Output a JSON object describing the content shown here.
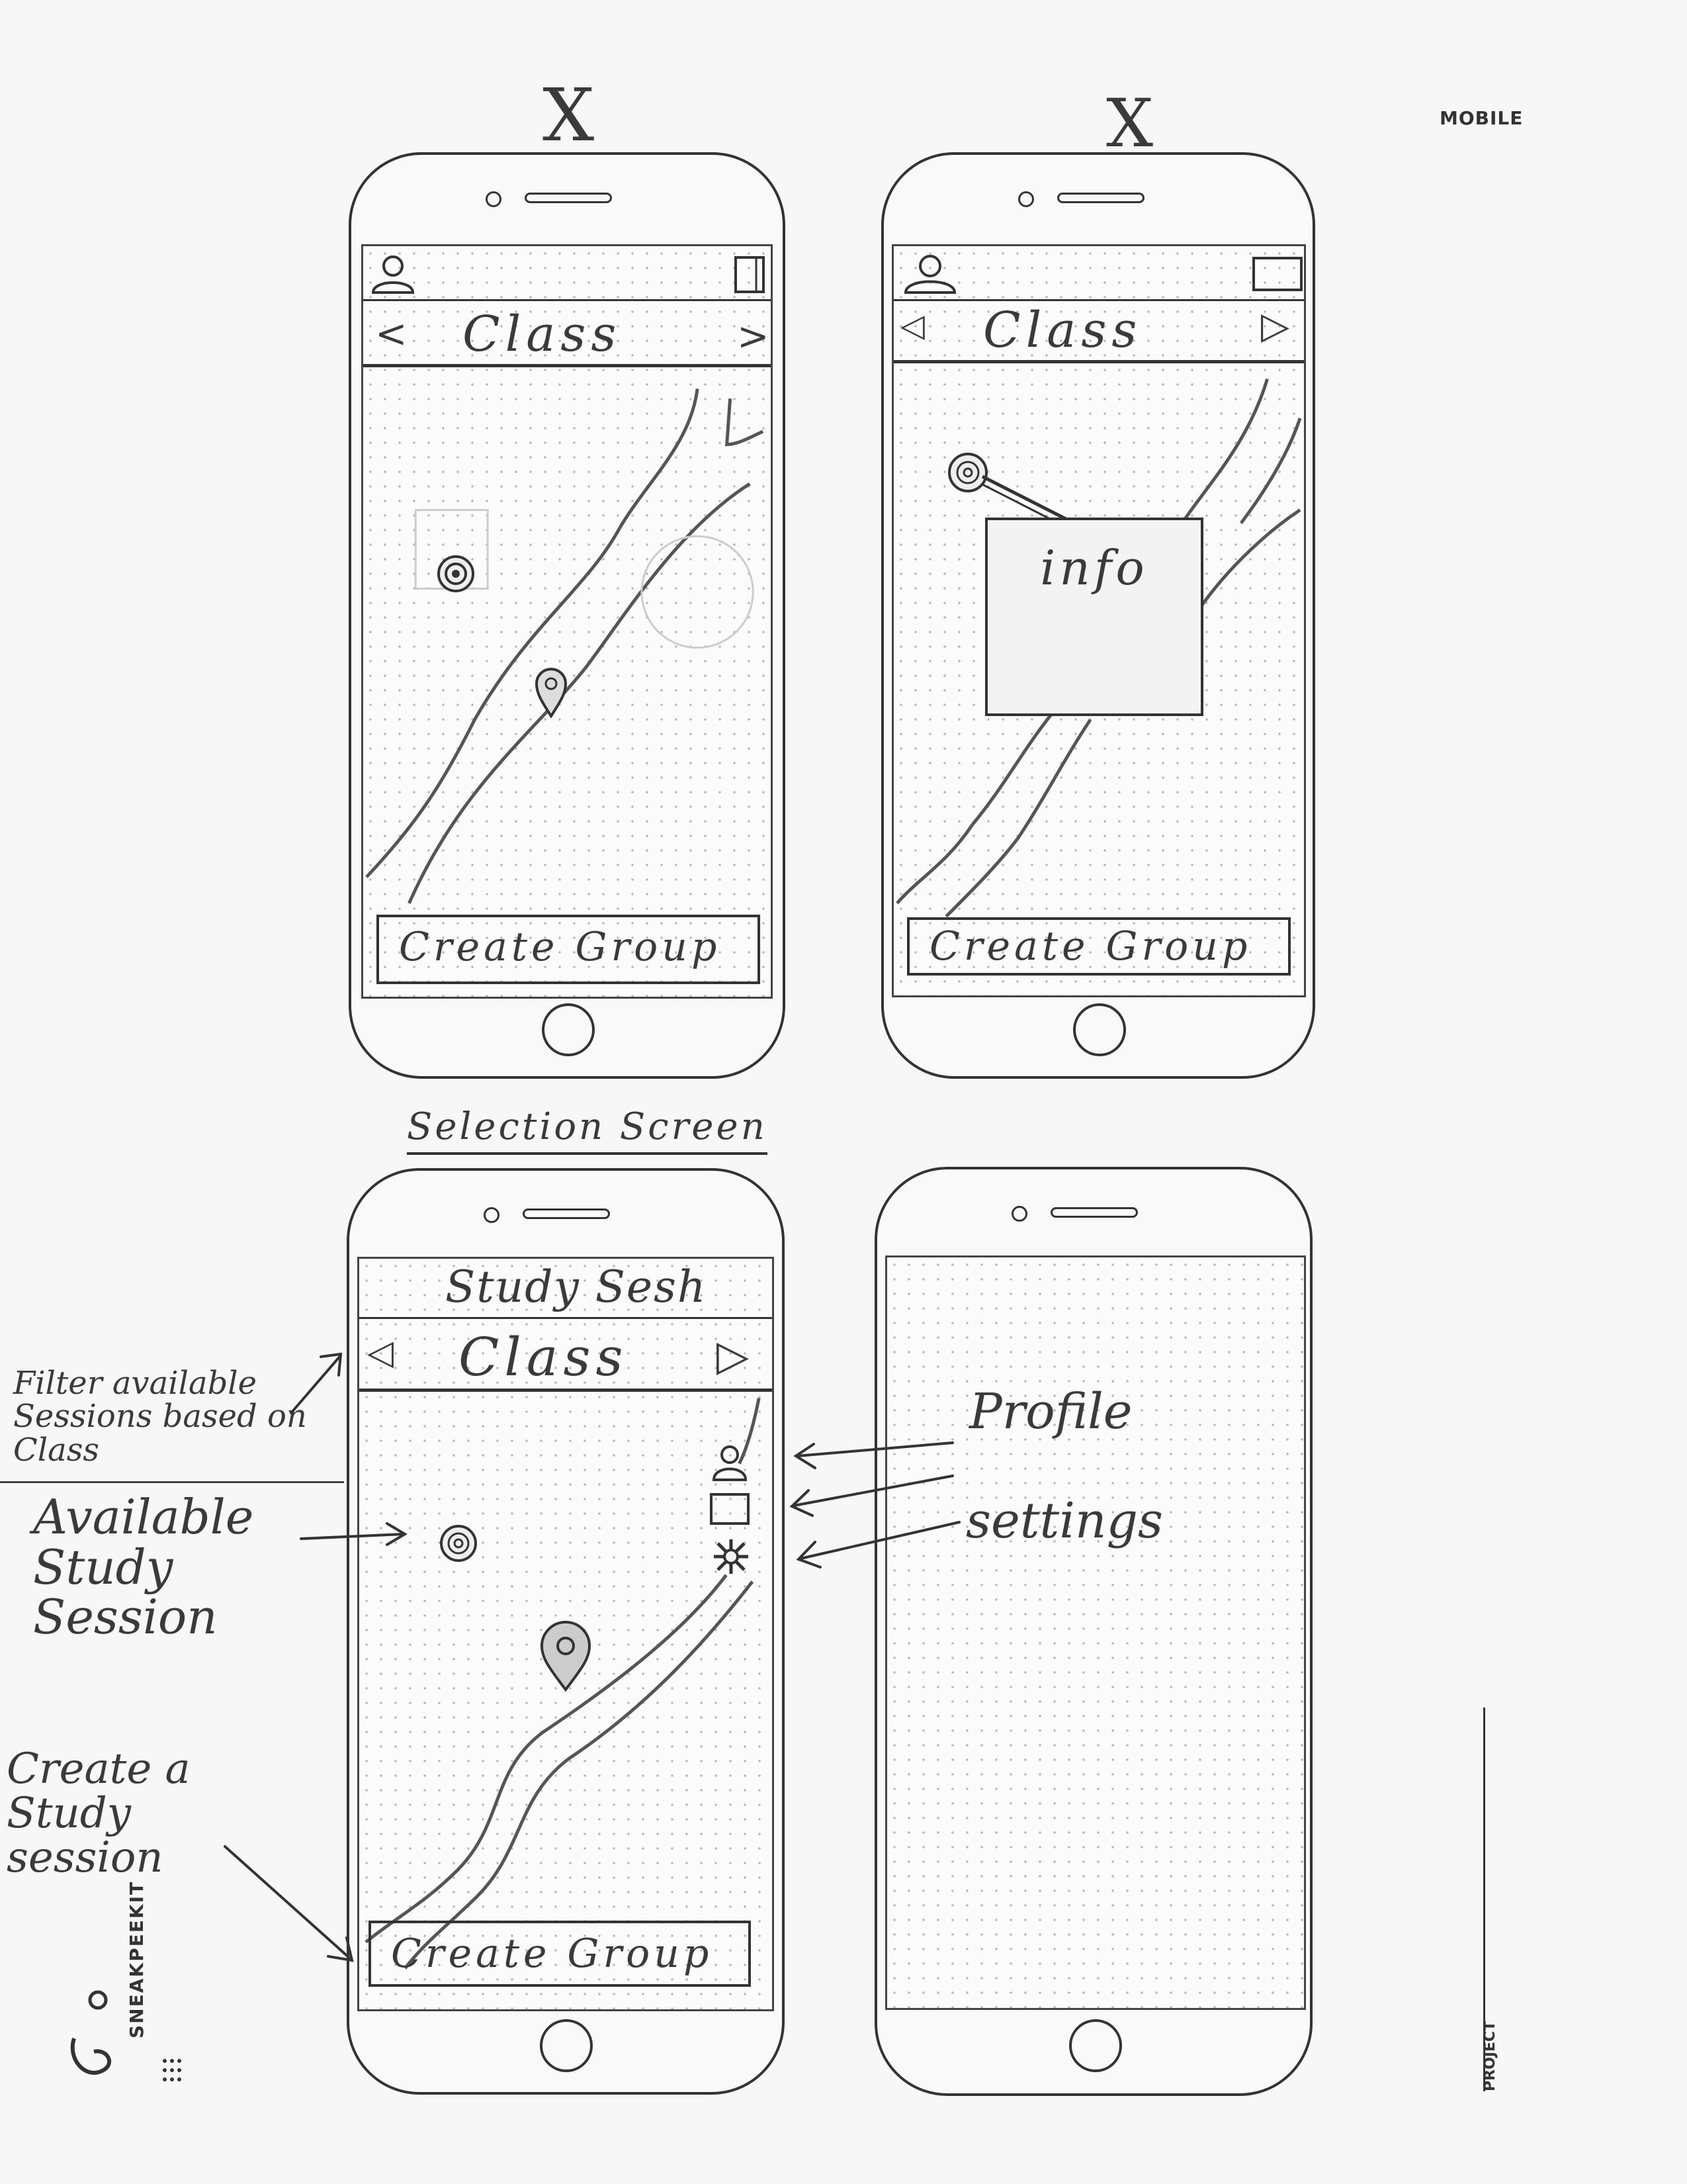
{
  "page": {
    "header_label": "MOBILE",
    "brand": "SNEAKPEEKIT",
    "project_label": "PROJECT",
    "reject_marks": [
      "X",
      "X"
    ]
  },
  "phone1": {
    "class_label": "Class",
    "prev_arrow": "<",
    "next_arrow": ">",
    "create_button": "Create Group",
    "icons": [
      "user-icon",
      "settings-icon",
      "study-session-icon",
      "location-pin-icon"
    ]
  },
  "phone2": {
    "class_label": "Class",
    "prev_arrow": "◁",
    "next_arrow": "▷",
    "info_popup": "info",
    "create_button": "Create Group",
    "icons": [
      "user-icon",
      "settings-icon",
      "study-session-icon"
    ]
  },
  "phone3": {
    "section_heading": "Selection Screen",
    "app_title": "Study Sesh",
    "class_label": "Class",
    "prev_arrow": "◁",
    "next_arrow": "▷",
    "create_button": "Create Group",
    "icons": [
      "user-icon",
      "settings-icon",
      "gear-icon",
      "study-session-icon",
      "location-pin-icon"
    ]
  },
  "annotations": {
    "filter": "Filter available Sessions based on Class",
    "available": "Available Study Session",
    "create": "Create a Study session",
    "profile": "Profile",
    "settings": "settings"
  }
}
